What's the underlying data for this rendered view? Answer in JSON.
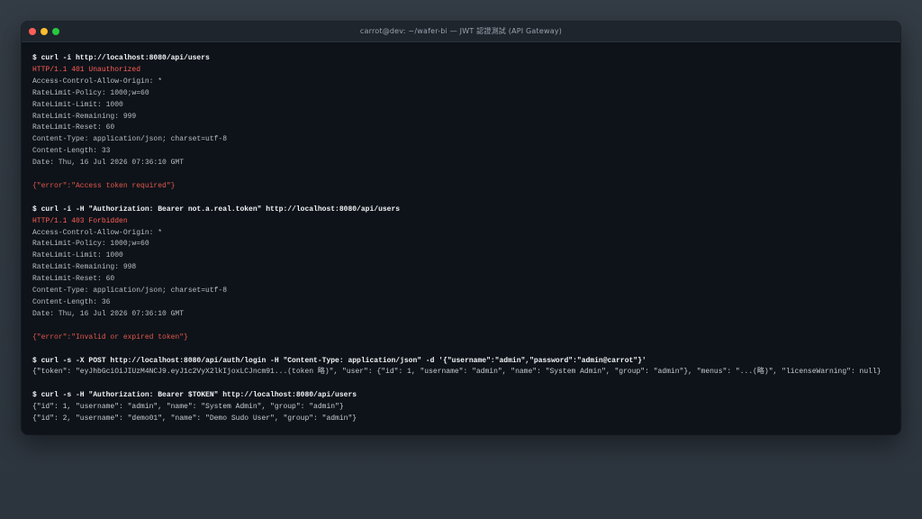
{
  "window": {
    "title": "carrot@dev: ~/wafer-bi — JWT 認證測試 (API Gateway)"
  },
  "terminal": {
    "lines": [
      {
        "kind": "cmd",
        "text": "$ curl -i http://localhost:8080/api/users"
      },
      {
        "kind": "status",
        "text": "HTTP/1.1 401 Unauthorized"
      },
      {
        "kind": "hdr",
        "text": "Access-Control-Allow-Origin: *"
      },
      {
        "kind": "hdr",
        "text": "RateLimit-Policy: 1000;w=60"
      },
      {
        "kind": "hdr",
        "text": "RateLimit-Limit: 1000"
      },
      {
        "kind": "hdr",
        "text": "RateLimit-Remaining: 999"
      },
      {
        "kind": "hdr",
        "text": "RateLimit-Reset: 60"
      },
      {
        "kind": "hdr",
        "text": "Content-Type: application/json; charset=utf-8"
      },
      {
        "kind": "hdr",
        "text": "Content-Length: 33"
      },
      {
        "kind": "hdr",
        "text": "Date: Thu, 16 Jul 2026 07:36:10 GMT"
      },
      {
        "kind": "blank",
        "text": ""
      },
      {
        "kind": "err",
        "text": "{\"error\":\"Access token required\"}"
      },
      {
        "kind": "blank",
        "text": ""
      },
      {
        "kind": "cmd",
        "text": "$ curl -i -H \"Authorization: Bearer not.a.real.token\" http://localhost:8080/api/users"
      },
      {
        "kind": "status",
        "text": "HTTP/1.1 403 Forbidden"
      },
      {
        "kind": "hdr",
        "text": "Access-Control-Allow-Origin: *"
      },
      {
        "kind": "hdr",
        "text": "RateLimit-Policy: 1000;w=60"
      },
      {
        "kind": "hdr",
        "text": "RateLimit-Limit: 1000"
      },
      {
        "kind": "hdr",
        "text": "RateLimit-Remaining: 998"
      },
      {
        "kind": "hdr",
        "text": "RateLimit-Reset: 60"
      },
      {
        "kind": "hdr",
        "text": "Content-Type: application/json; charset=utf-8"
      },
      {
        "kind": "hdr",
        "text": "Content-Length: 36"
      },
      {
        "kind": "hdr",
        "text": "Date: Thu, 16 Jul 2026 07:36:10 GMT"
      },
      {
        "kind": "blank",
        "text": ""
      },
      {
        "kind": "err",
        "text": "{\"error\":\"Invalid or expired token\"}"
      },
      {
        "kind": "blank",
        "text": ""
      },
      {
        "kind": "cmd",
        "text": "$ curl -s -X POST http://localhost:8080/api/auth/login -H \"Content-Type: application/json\" -d '{\"username\":\"admin\",\"password\":\"admin@carrot\"}'"
      },
      {
        "kind": "json",
        "text": "{\"token\": \"eyJhbGciOiJIUzM4NCJ9.eyJ1c2VyX2lkIjoxLCJncm91...(token 略)\", \"user\": {\"id\": 1, \"username\": \"admin\", \"name\": \"System Admin\", \"group\": \"admin\"}, \"menus\": \"...(略)\", \"licenseWarning\": null}"
      },
      {
        "kind": "blank",
        "text": ""
      },
      {
        "kind": "cmd",
        "text": "$ curl -s -H \"Authorization: Bearer $TOKEN\" http://localhost:8080/api/users"
      },
      {
        "kind": "json",
        "text": "{\"id\": 1, \"username\": \"admin\", \"name\": \"System Admin\", \"group\": \"admin\"}"
      },
      {
        "kind": "json",
        "text": "{\"id\": 2, \"username\": \"demo01\", \"name\": \"Demo Sudo User\", \"group\": \"admin\"}"
      }
    ]
  },
  "colors": {
    "command": "#f2f5f8",
    "status_error": "#ff5d55",
    "json_error": "#e2574c",
    "background": "#0e1319"
  }
}
